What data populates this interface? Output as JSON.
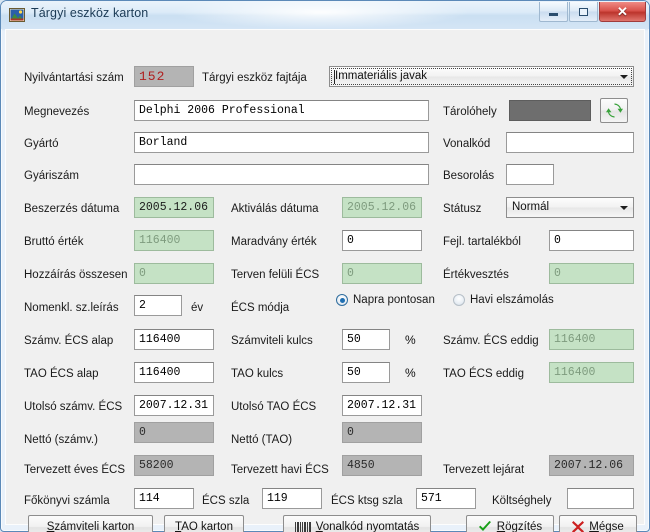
{
  "window": {
    "title": "Tárgyi eszköz karton",
    "icon": "app-photo-icon",
    "minimize_label": "",
    "maximize_label": "",
    "close_label": "✕",
    "accent_close": "#c9302c"
  },
  "form": {
    "nyilvantartasi_szam": {
      "label": "Nyilvántartási szám",
      "value": "152"
    },
    "targyi_eszkoz_fajtaja": {
      "label": "Tárgyi eszköz fajtája",
      "value": "Immateriális javak"
    },
    "megnevezes": {
      "label": "Megnevezés",
      "value": "Delphi 2006 Professional"
    },
    "tarolohely": {
      "label": "Tárolóhely",
      "value": ""
    },
    "refresh": {
      "icon": "refresh-icon"
    },
    "gyarto": {
      "label": "Gyártó",
      "value": "Borland"
    },
    "vonalkod": {
      "label": "Vonalkód",
      "value": ""
    },
    "gyariszam": {
      "label": "Gyáriszám",
      "value": ""
    },
    "besorolas": {
      "label": "Besorolás",
      "value": ""
    },
    "beszerzes_datuma": {
      "label": "Beszerzés dátuma",
      "value": "2005.12.06"
    },
    "aktivalas_datuma": {
      "label": "Aktiválás dátuma",
      "value": "2005.12.06"
    },
    "statusz": {
      "label": "Státusz",
      "value": "Normál"
    },
    "brutto_ertek": {
      "label": "Bruttó érték",
      "value": "116400"
    },
    "maradvany_ertek": {
      "label": "Maradvány érték",
      "value": "0"
    },
    "fejl_tartalekbol": {
      "label": "Fejl. tartalékból",
      "value": "0"
    },
    "hozzairas_osszesen": {
      "label": "Hozzáírás összesen",
      "value": "0"
    },
    "terven_feluli_ecs": {
      "label": "Terven felüli ÉCS",
      "value": "0"
    },
    "ertekvesztes": {
      "label": "Értékvesztés",
      "value": "0"
    },
    "nomenkl_sz_leiras": {
      "label": "Nomenkl. sz.leírás",
      "value": "2",
      "unit": "év"
    },
    "ecs_modja": {
      "label": "ÉCS módja",
      "options": [
        {
          "label": "Napra pontosan",
          "selected": true
        },
        {
          "label": "Havi elszámolás",
          "selected": false
        }
      ]
    },
    "szamv_ecs_alap": {
      "label": "Számv. ÉCS alap",
      "value": "116400"
    },
    "szamviteli_kulcs": {
      "label": "Számviteli kulcs",
      "value": "50",
      "unit": "%"
    },
    "szamv_ecs_eddig": {
      "label": "Számv. ÉCS eddig",
      "value": "116400"
    },
    "tao_ecs_alap": {
      "label": "TAO ÉCS alap",
      "value": "116400"
    },
    "tao_kulcs": {
      "label": "TAO kulcs",
      "value": "50",
      "unit": "%"
    },
    "tao_ecs_eddig": {
      "label": "TAO ÉCS eddig",
      "value": "116400"
    },
    "utolso_szamv_ecs": {
      "label": "Utolsó számv. ÉCS",
      "value": "2007.12.31"
    },
    "utolso_tao_ecs": {
      "label": "Utolsó TAO ÉCS",
      "value": "2007.12.31"
    },
    "netto_szamv": {
      "label": "Nettó (számv.)",
      "value": "0"
    },
    "netto_tao": {
      "label": "Nettó (TAO)",
      "value": "0"
    },
    "tervezett_eves_ecs": {
      "label": "Tervezett éves ÉCS",
      "value": "58200"
    },
    "tervezett_havi_ecs": {
      "label": "Tervezett havi ÉCS",
      "value": "4850"
    },
    "tervezett_lejarat": {
      "label": "Tervezett lejárat",
      "value": "2007.12.06"
    },
    "fokonyvi_szamla": {
      "label": "Főkönyvi számla",
      "value": "114"
    },
    "ecs_szla": {
      "label": "ÉCS szla",
      "value": "119"
    },
    "ecs_ktsg_szla": {
      "label": "ÉCS ktsg szla",
      "value": "571"
    },
    "koltseghely": {
      "label": "Költséghely",
      "value": ""
    }
  },
  "buttons": {
    "szamviteli_karton": {
      "accel": "S",
      "rest": "zámviteli karton"
    },
    "tao_karton": {
      "accel": "T",
      "rest": "AO karton"
    },
    "vonalkod_nyomtatas": {
      "accel": "V",
      "rest": "onalkód nyomtatás",
      "icon": "barcode-icon"
    },
    "rogzites": {
      "accel": "R",
      "rest": "ögzítés",
      "icon": "check-icon",
      "color": "#1a9e1a"
    },
    "megse": {
      "accel": "M",
      "rest": "égse",
      "icon": "x-icon",
      "color": "#cc2020"
    }
  }
}
